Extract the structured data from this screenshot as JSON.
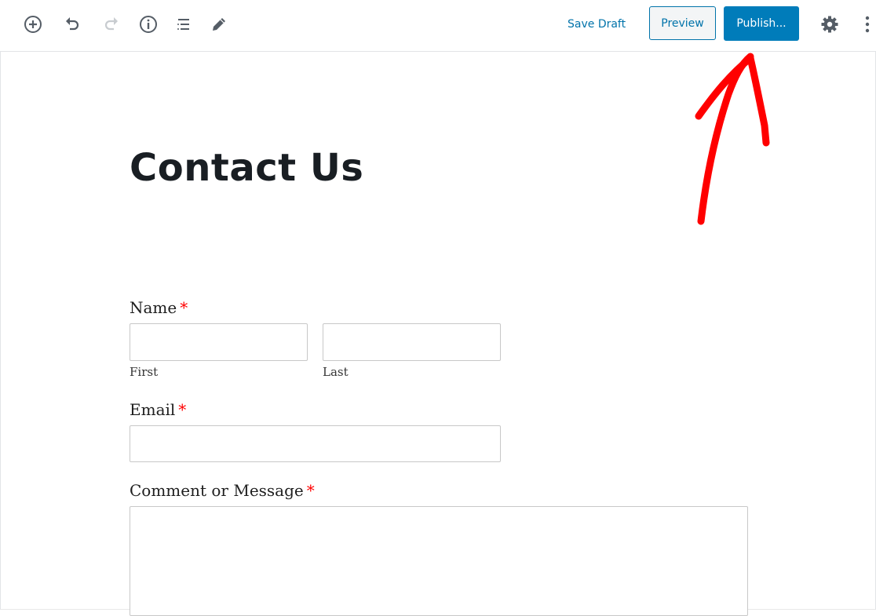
{
  "toolbar": {
    "left_icons": [
      {
        "name": "add-block-icon",
        "label": "Add block"
      },
      {
        "name": "undo-icon",
        "label": "Undo"
      },
      {
        "name": "redo-icon",
        "label": "Redo"
      },
      {
        "name": "info-icon",
        "label": "Content structure"
      },
      {
        "name": "list-view-icon",
        "label": "Block navigation"
      },
      {
        "name": "edit-tools-icon",
        "label": "Tools"
      }
    ],
    "save_draft_label": "Save Draft",
    "preview_label": "Preview",
    "publish_label": "Publish...",
    "settings_icon": "gear-icon",
    "more_icon": "more-vertical-icon"
  },
  "colors": {
    "accent": "#007cba",
    "link": "#0073aa",
    "required": "#ff0000",
    "annotation_arrow": "#ff0000"
  },
  "page": {
    "title": "Contact Us"
  },
  "form": {
    "name": {
      "label": "Name",
      "required_marker": "*",
      "first_sublabel": "First",
      "last_sublabel": "Last",
      "first_value": "",
      "last_value": ""
    },
    "email": {
      "label": "Email",
      "required_marker": "*",
      "value": ""
    },
    "message": {
      "label": "Comment or Message",
      "required_marker": "*",
      "value": ""
    }
  }
}
